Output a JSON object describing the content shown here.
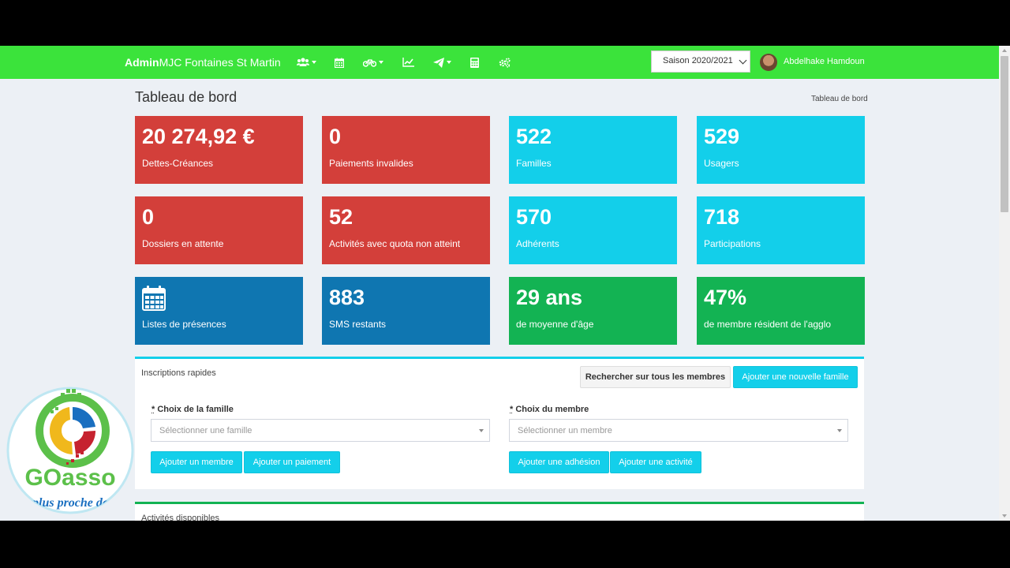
{
  "app": {
    "brand_bold": "Admin",
    "brand_rest": "MJC Fontaines St Martin",
    "season_select": "Saison 2020/2021",
    "username": "Abdelhake Hamdoun",
    "nav_icons": [
      "users-icon",
      "calendar-icon",
      "bicycle-icon",
      "line-chart-icon",
      "paper-plane-icon",
      "calculator-icon",
      "cogs-icon"
    ]
  },
  "page": {
    "title": "Tableau de bord",
    "breadcrumb": "Tableau de bord"
  },
  "tiles": [
    {
      "value": "20 274,92 €",
      "label": "Dettes-Créances",
      "color": "#d33f3a"
    },
    {
      "value": "0",
      "label": "Paiements invalides",
      "color": "#d33f3a"
    },
    {
      "value": "522",
      "label": "Familles",
      "color": "#13cfea"
    },
    {
      "value": "529",
      "label": "Usagers",
      "color": "#13cfea"
    },
    {
      "value": "0",
      "label": "Dossiers en attente",
      "color": "#d33f3a"
    },
    {
      "value": "52",
      "label": "Activités avec quota non atteint",
      "color": "#d33f3a"
    },
    {
      "value": "570",
      "label": "Adhérents",
      "color": "#13cfea"
    },
    {
      "value": "718",
      "label": "Participations",
      "color": "#13cfea"
    },
    {
      "icon": "calendar-icon",
      "label": "Listes de présences",
      "color": "#0f76b1"
    },
    {
      "value": "883",
      "label": "SMS restants",
      "color": "#0f76b1"
    },
    {
      "value": "29 ans",
      "label": "de moyenne d'âge",
      "color": "#13b353"
    },
    {
      "value": "47%",
      "label": "de membre résident de l'agglo",
      "color": "#13b353"
    }
  ],
  "quick": {
    "title": "Inscriptions rapides",
    "search_all_label": "Rechercher sur tous les membres",
    "add_family_label": "Ajouter une nouvelle famille",
    "family_label": "Choix de la famille",
    "family_placeholder": "Sélectionner une famille",
    "member_label": "Choix du membre",
    "member_placeholder": "Sélectionner un membre",
    "required_mark": "*",
    "add_member_label": "Ajouter un membre",
    "add_payment_label": "Ajouter un paiement",
    "add_membership_label": "Ajouter une adhésion",
    "add_activity_label": "Ajouter une activité"
  },
  "activities": {
    "title": "Activités disponibles"
  },
  "watermark": {
    "logo_text": "GOasso",
    "tagline": "plus proche de"
  }
}
